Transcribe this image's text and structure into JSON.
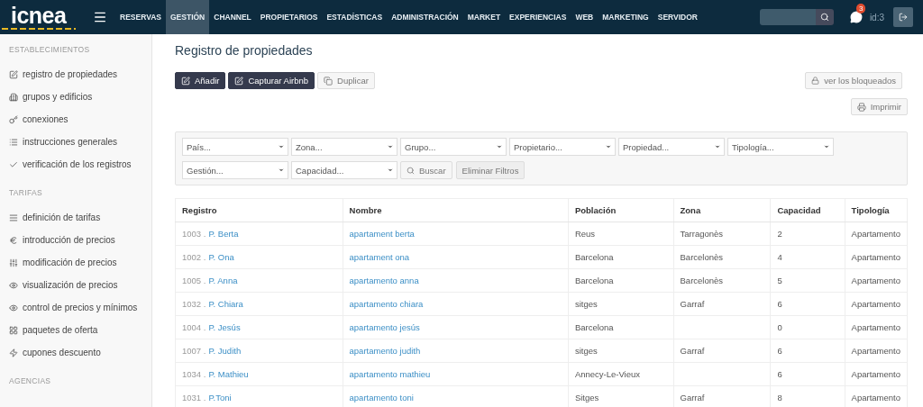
{
  "topbar": {
    "logo": "icnea",
    "nav": [
      {
        "label": "RESERVAS",
        "selected": false
      },
      {
        "label": "GESTIÓN",
        "selected": true
      },
      {
        "label": "CHANNEL",
        "selected": false
      },
      {
        "label": "PROPIETARIOS",
        "selected": false
      },
      {
        "label": "ESTADÍSTICAS",
        "selected": false
      },
      {
        "label": "ADMINISTRACIÓN",
        "selected": false
      },
      {
        "label": "MARKET",
        "selected": false
      },
      {
        "label": "EXPERIENCIAS",
        "selected": false
      },
      {
        "label": "WEB",
        "selected": false
      },
      {
        "label": "MARKETING",
        "selected": false
      },
      {
        "label": "SERVIDOR",
        "selected": false
      }
    ],
    "notifications_badge": "3",
    "user": "id:3"
  },
  "sidebar": {
    "sections": [
      {
        "title": "ESTABLECIMIENTOS",
        "items": [
          "registro de propiedades",
          "grupos y edificios",
          "conexiones",
          "instrucciones generales",
          "verificación de los registros"
        ]
      },
      {
        "title": "TARIFAS",
        "items": [
          "definición de tarifas",
          "introducción de precios",
          "modificación de precios",
          "visualización de precios",
          "control de precios y mínimos",
          "paquetes de oferta",
          "cupones descuento"
        ]
      },
      {
        "title": "AGENCIAS"
      }
    ]
  },
  "page": {
    "title": "Registro de propiedades",
    "actions": [
      {
        "label": "Añadir",
        "kind": "primary"
      },
      {
        "label": "Capturar Airbnb",
        "kind": "primary"
      },
      {
        "label": "Duplicar",
        "kind": "default"
      }
    ],
    "blocked_button": "ver los bloqueados",
    "print_button": "Imprimir",
    "filters": [
      "País...",
      "Zona...",
      "Grupo...",
      "Propietario...",
      "Propiedad...",
      "Tipología...",
      "Gestión...",
      "Capacidad..."
    ],
    "search_button": "Buscar",
    "clear_button": "Eliminar Filtros"
  },
  "table": {
    "columns": [
      "Registro",
      "Nombre",
      "Población",
      "Zona",
      "Capacidad",
      "Tipología"
    ],
    "rows": [
      {
        "id": "1003 .",
        "owner": "P. Berta",
        "name": "apartament berta",
        "town": "Reus",
        "zone": "Tarragonès",
        "capacity": "2",
        "type": "Apartamento"
      },
      {
        "id": "1002 .",
        "owner": "P. Ona",
        "name": "apartament ona",
        "town": "Barcelona",
        "zone": "Barcelonès",
        "capacity": "4",
        "type": "Apartamento"
      },
      {
        "id": "1005 .",
        "owner": "P. Anna",
        "name": "apartamento anna",
        "town": "Barcelona",
        "zone": "Barcelonès",
        "capacity": "5",
        "type": "Apartamento"
      },
      {
        "id": "1032 .",
        "owner": "P. Chiara",
        "name": "apartamento chiara",
        "town": "sitges",
        "zone": "Garraf",
        "capacity": "6",
        "type": "Apartamento"
      },
      {
        "id": "1004 .",
        "owner": "P. Jesús",
        "name": "apartamento jesús",
        "town": "Barcelona",
        "capacity": "0",
        "type": "Apartamento"
      },
      {
        "id": "1007 .",
        "owner": "P. Judith",
        "name": "apartamento judith",
        "town": "sitges",
        "zone": "Garraf",
        "capacity": "6",
        "type": "Apartamento"
      },
      {
        "id": "1034 .",
        "owner": "P. Mathieu",
        "name": "apartamento mathieu",
        "town": "Annecy-Le-Vieux",
        "capacity": "6",
        "type": "Apartamento"
      },
      {
        "id": "1031 .",
        "owner": "P.Toni",
        "name": "apartamento toni",
        "town": "Sitges",
        "zone": "Garraf",
        "capacity": "8",
        "type": "Apartamento"
      }
    ]
  }
}
